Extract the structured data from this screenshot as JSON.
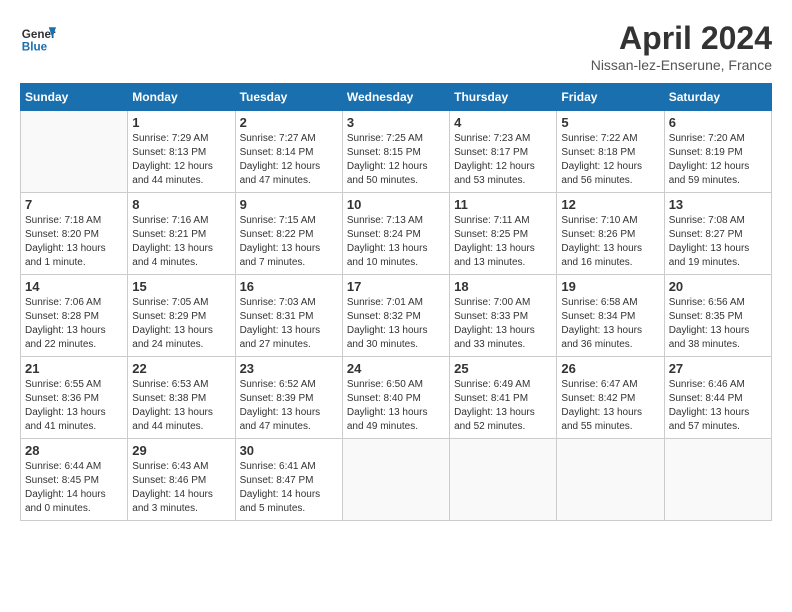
{
  "header": {
    "logo_line1": "General",
    "logo_line2": "Blue",
    "month": "April 2024",
    "location": "Nissan-lez-Enserune, France"
  },
  "days_of_week": [
    "Sunday",
    "Monday",
    "Tuesday",
    "Wednesday",
    "Thursday",
    "Friday",
    "Saturday"
  ],
  "weeks": [
    [
      {
        "day": "",
        "info": ""
      },
      {
        "day": "1",
        "info": "Sunrise: 7:29 AM\nSunset: 8:13 PM\nDaylight: 12 hours\nand 44 minutes."
      },
      {
        "day": "2",
        "info": "Sunrise: 7:27 AM\nSunset: 8:14 PM\nDaylight: 12 hours\nand 47 minutes."
      },
      {
        "day": "3",
        "info": "Sunrise: 7:25 AM\nSunset: 8:15 PM\nDaylight: 12 hours\nand 50 minutes."
      },
      {
        "day": "4",
        "info": "Sunrise: 7:23 AM\nSunset: 8:17 PM\nDaylight: 12 hours\nand 53 minutes."
      },
      {
        "day": "5",
        "info": "Sunrise: 7:22 AM\nSunset: 8:18 PM\nDaylight: 12 hours\nand 56 minutes."
      },
      {
        "day": "6",
        "info": "Sunrise: 7:20 AM\nSunset: 8:19 PM\nDaylight: 12 hours\nand 59 minutes."
      }
    ],
    [
      {
        "day": "7",
        "info": "Sunrise: 7:18 AM\nSunset: 8:20 PM\nDaylight: 13 hours\nand 1 minute."
      },
      {
        "day": "8",
        "info": "Sunrise: 7:16 AM\nSunset: 8:21 PM\nDaylight: 13 hours\nand 4 minutes."
      },
      {
        "day": "9",
        "info": "Sunrise: 7:15 AM\nSunset: 8:22 PM\nDaylight: 13 hours\nand 7 minutes."
      },
      {
        "day": "10",
        "info": "Sunrise: 7:13 AM\nSunset: 8:24 PM\nDaylight: 13 hours\nand 10 minutes."
      },
      {
        "day": "11",
        "info": "Sunrise: 7:11 AM\nSunset: 8:25 PM\nDaylight: 13 hours\nand 13 minutes."
      },
      {
        "day": "12",
        "info": "Sunrise: 7:10 AM\nSunset: 8:26 PM\nDaylight: 13 hours\nand 16 minutes."
      },
      {
        "day": "13",
        "info": "Sunrise: 7:08 AM\nSunset: 8:27 PM\nDaylight: 13 hours\nand 19 minutes."
      }
    ],
    [
      {
        "day": "14",
        "info": "Sunrise: 7:06 AM\nSunset: 8:28 PM\nDaylight: 13 hours\nand 22 minutes."
      },
      {
        "day": "15",
        "info": "Sunrise: 7:05 AM\nSunset: 8:29 PM\nDaylight: 13 hours\nand 24 minutes."
      },
      {
        "day": "16",
        "info": "Sunrise: 7:03 AM\nSunset: 8:31 PM\nDaylight: 13 hours\nand 27 minutes."
      },
      {
        "day": "17",
        "info": "Sunrise: 7:01 AM\nSunset: 8:32 PM\nDaylight: 13 hours\nand 30 minutes."
      },
      {
        "day": "18",
        "info": "Sunrise: 7:00 AM\nSunset: 8:33 PM\nDaylight: 13 hours\nand 33 minutes."
      },
      {
        "day": "19",
        "info": "Sunrise: 6:58 AM\nSunset: 8:34 PM\nDaylight: 13 hours\nand 36 minutes."
      },
      {
        "day": "20",
        "info": "Sunrise: 6:56 AM\nSunset: 8:35 PM\nDaylight: 13 hours\nand 38 minutes."
      }
    ],
    [
      {
        "day": "21",
        "info": "Sunrise: 6:55 AM\nSunset: 8:36 PM\nDaylight: 13 hours\nand 41 minutes."
      },
      {
        "day": "22",
        "info": "Sunrise: 6:53 AM\nSunset: 8:38 PM\nDaylight: 13 hours\nand 44 minutes."
      },
      {
        "day": "23",
        "info": "Sunrise: 6:52 AM\nSunset: 8:39 PM\nDaylight: 13 hours\nand 47 minutes."
      },
      {
        "day": "24",
        "info": "Sunrise: 6:50 AM\nSunset: 8:40 PM\nDaylight: 13 hours\nand 49 minutes."
      },
      {
        "day": "25",
        "info": "Sunrise: 6:49 AM\nSunset: 8:41 PM\nDaylight: 13 hours\nand 52 minutes."
      },
      {
        "day": "26",
        "info": "Sunrise: 6:47 AM\nSunset: 8:42 PM\nDaylight: 13 hours\nand 55 minutes."
      },
      {
        "day": "27",
        "info": "Sunrise: 6:46 AM\nSunset: 8:44 PM\nDaylight: 13 hours\nand 57 minutes."
      }
    ],
    [
      {
        "day": "28",
        "info": "Sunrise: 6:44 AM\nSunset: 8:45 PM\nDaylight: 14 hours\nand 0 minutes."
      },
      {
        "day": "29",
        "info": "Sunrise: 6:43 AM\nSunset: 8:46 PM\nDaylight: 14 hours\nand 3 minutes."
      },
      {
        "day": "30",
        "info": "Sunrise: 6:41 AM\nSunset: 8:47 PM\nDaylight: 14 hours\nand 5 minutes."
      },
      {
        "day": "",
        "info": ""
      },
      {
        "day": "",
        "info": ""
      },
      {
        "day": "",
        "info": ""
      },
      {
        "day": "",
        "info": ""
      }
    ]
  ]
}
